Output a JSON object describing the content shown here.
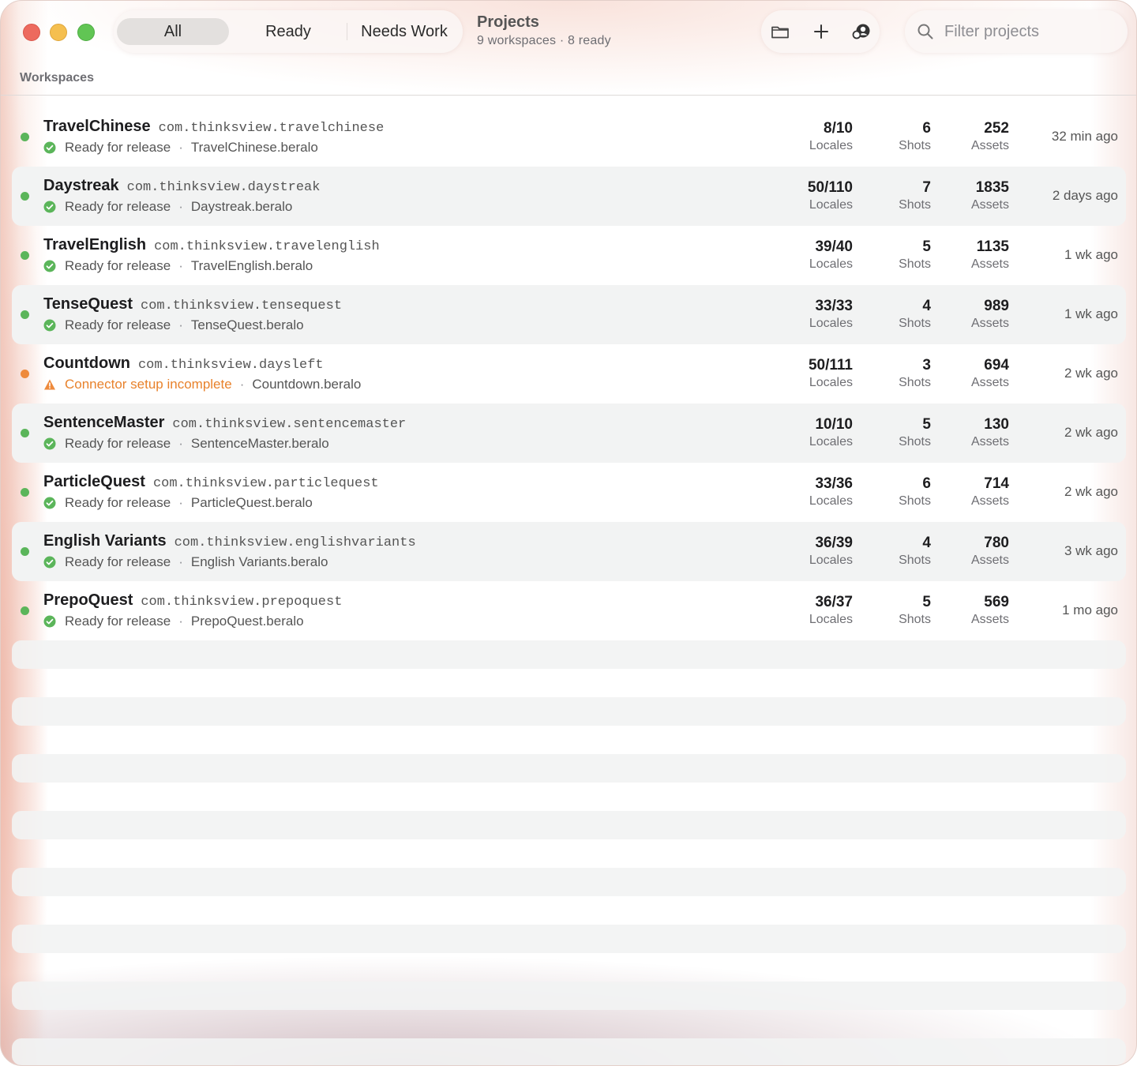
{
  "toolbar": {
    "segments": [
      "All",
      "Ready",
      "Needs Work"
    ],
    "active_segment": "All",
    "title": "Projects",
    "subtitle": "9 workspaces · 8 ready",
    "tools": [
      "folder-icon",
      "plus-icon",
      "account-icon"
    ],
    "search_placeholder": "Filter projects"
  },
  "section_label": "Workspaces",
  "colors": {
    "ready": "#5bb55a",
    "warn": "#ee8a3c"
  },
  "projects": [
    {
      "name": "TravelChinese",
      "bundle": "com.thinksview.travelchinese",
      "status": "Ready for release",
      "file": "TravelChinese.beralo",
      "locales": "8/10",
      "shots": "6",
      "assets": "252",
      "updated": "32 min ago",
      "state": "ready"
    },
    {
      "name": "Daystreak",
      "bundle": "com.thinksview.daystreak",
      "status": "Ready for release",
      "file": "Daystreak.beralo",
      "locales": "50/110",
      "shots": "7",
      "assets": "1835",
      "updated": "2 days ago",
      "state": "ready"
    },
    {
      "name": "TravelEnglish",
      "bundle": "com.thinksview.travelenglish",
      "status": "Ready for release",
      "file": "TravelEnglish.beralo",
      "locales": "39/40",
      "shots": "5",
      "assets": "1135",
      "updated": "1 wk ago",
      "state": "ready"
    },
    {
      "name": "TenseQuest",
      "bundle": "com.thinksview.tensequest",
      "status": "Ready for release",
      "file": "TenseQuest.beralo",
      "locales": "33/33",
      "shots": "4",
      "assets": "989",
      "updated": "1 wk ago",
      "state": "ready"
    },
    {
      "name": "Countdown",
      "bundle": "com.thinksview.daysleft",
      "status": "Connector setup incomplete",
      "file": "Countdown.beralo",
      "locales": "50/111",
      "shots": "3",
      "assets": "694",
      "updated": "2 wk ago",
      "state": "warn"
    },
    {
      "name": "SentenceMaster",
      "bundle": "com.thinksview.sentencemaster",
      "status": "Ready for release",
      "file": "SentenceMaster.beralo",
      "locales": "10/10",
      "shots": "5",
      "assets": "130",
      "updated": "2 wk ago",
      "state": "ready"
    },
    {
      "name": "ParticleQuest",
      "bundle": "com.thinksview.particlequest",
      "status": "Ready for release",
      "file": "ParticleQuest.beralo",
      "locales": "33/36",
      "shots": "6",
      "assets": "714",
      "updated": "2 wk ago",
      "state": "ready"
    },
    {
      "name": "English Variants",
      "bundle": "com.thinksview.englishvariants",
      "status": "Ready for release",
      "file": "English Variants.beralo",
      "locales": "36/39",
      "shots": "4",
      "assets": "780",
      "updated": "3 wk ago",
      "state": "ready"
    },
    {
      "name": "PrepoQuest",
      "bundle": "com.thinksview.prepoquest",
      "status": "Ready for release",
      "file": "PrepoQuest.beralo",
      "locales": "36/37",
      "shots": "5",
      "assets": "569",
      "updated": "1 mo ago",
      "state": "ready"
    }
  ],
  "stat_labels": {
    "locales": "Locales",
    "shots": "Shots",
    "assets": "Assets"
  }
}
